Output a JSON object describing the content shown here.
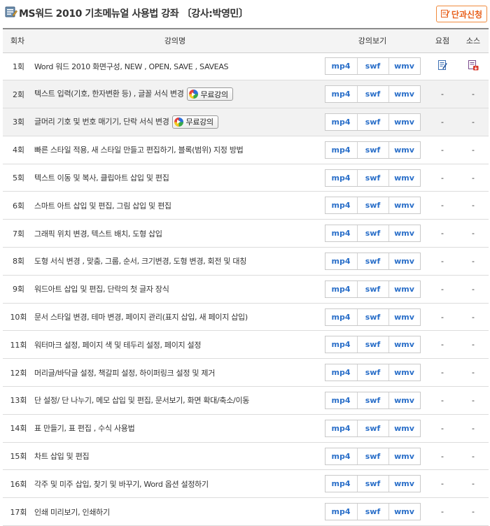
{
  "header": {
    "title": "MS워드 2010 기초메뉴얼 사용법 강좌 〔강사:박영민〕",
    "apply_button": "단과신청"
  },
  "table": {
    "columns": [
      "회차",
      "강의명",
      "강의보기",
      "요점",
      "소스"
    ],
    "free_badge": "무료강의",
    "formats": [
      "mp4",
      "swf",
      "wmv"
    ],
    "dash": "-",
    "rows": [
      {
        "no": "1회",
        "title": "Word 워드 2010 화면구성, NEW , OPEN, SAVE , SAVEAS",
        "free": false,
        "summary": "icon",
        "source": "icon"
      },
      {
        "no": "2회",
        "title": "텍스트 입력(기호, 한자변환 등) , 글꼴 서식 변경",
        "free": true
      },
      {
        "no": "3회",
        "title": "글머리 기호 및 번호 매기기, 단락 서식 변경",
        "free": true
      },
      {
        "no": "4회",
        "title": "빠른 스타일 적용, 새 스타일 만들고 편집하기, 블록(범위) 지정 방법",
        "free": false
      },
      {
        "no": "5회",
        "title": "텍스트 이동 및 복사, 클립아트 삽입 및 편집",
        "free": false
      },
      {
        "no": "6회",
        "title": "스마트 아트 삽입 및 편집, 그림 삽입 및 편집",
        "free": false
      },
      {
        "no": "7회",
        "title": "그래픽 위치 변경, 텍스트 배치, 도형 삽입",
        "free": false
      },
      {
        "no": "8회",
        "title": "도형 서식 변경 , 맞춤, 그룹, 순서, 크기변경, 도형 변경, 회전 및 대칭",
        "free": false
      },
      {
        "no": "9회",
        "title": "워드아트 삽입 및 편집, 단락의 첫 글자 장식",
        "free": false
      },
      {
        "no": "10회",
        "title": "문서 스타일 변경, 테마 변경, 페이지 관리(표지 삽입, 새 페이지 삽입)",
        "free": false
      },
      {
        "no": "11회",
        "title": "워터마크 설정, 페이지 색 및 테두리 설정, 페이지 설정",
        "free": false
      },
      {
        "no": "12회",
        "title": "머리글/바닥글 설정, 책갈피 설정, 하이퍼링크 설정 및 제거",
        "free": false
      },
      {
        "no": "13회",
        "title": "단 설정/ 단 나누기, 메모 삽입 및 편집, 문서보기, 화면 확대/축소/이동",
        "free": false
      },
      {
        "no": "14회",
        "title": "표 만들기, 표 편집 , 수식 사용법",
        "free": false
      },
      {
        "no": "15회",
        "title": "차트 삽입 및 편집",
        "free": false
      },
      {
        "no": "16회",
        "title": "각주 및 미주 삽입, 찾기 및 바꾸기, Word 옵션 설정하기",
        "free": false
      },
      {
        "no": "17회",
        "title": "인쇄 미리보기, 인쇄하기",
        "free": false
      }
    ]
  },
  "icons": {
    "title": "list-edit-icon",
    "apply": "edit-note-icon",
    "free": "play-circle-icon",
    "summary": "document-edit-icon",
    "source": "download-file-icon"
  }
}
